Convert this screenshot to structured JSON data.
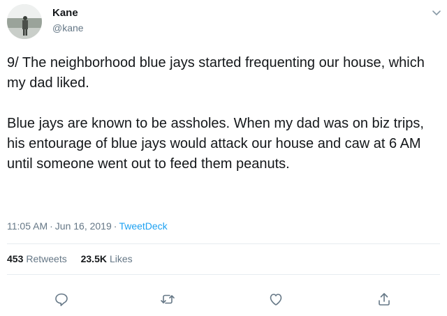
{
  "author": {
    "display_name": "Kane",
    "handle": "@kane"
  },
  "tweet": {
    "paragraphs": [
      "9/ The neighborhood blue jays started frequenting our house, which my dad liked.",
      "Blue jays are known to be assholes. When my dad was on biz trips, his entourage of blue jays would attack our house and caw at 6 AM until someone went out to feed them peanuts."
    ],
    "time": "11:05 AM",
    "separator": "·",
    "date": "Jun 16, 2019",
    "source": "TweetDeck"
  },
  "stats": {
    "retweets_count": "453",
    "retweets_label": "Retweets",
    "likes_count": "23.5K",
    "likes_label": "Likes"
  },
  "icons": {
    "more": "chevron-down-icon",
    "reply": "reply-icon",
    "retweet": "retweet-icon",
    "like": "heart-icon",
    "share": "share-icon"
  },
  "colors": {
    "text": "#14171a",
    "muted": "#657786",
    "link": "#1da1f2",
    "divider": "#e6ecf0"
  }
}
